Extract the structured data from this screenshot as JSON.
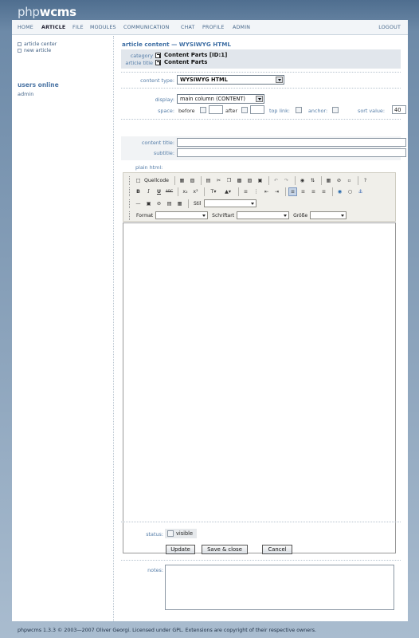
{
  "app": {
    "logo_php": "php",
    "logo_wcms": "wcms"
  },
  "nav": {
    "items": [
      "HOME",
      "ARTICLE",
      "FILE",
      "MODULES",
      "COMMUNICATION",
      "CHAT",
      "PROFILE",
      "ADMIN"
    ],
    "active": "ARTICLE",
    "logout": "LOGOUT"
  },
  "sidebar": {
    "links": [
      "article center",
      "new article"
    ],
    "users_online_heading": "users online",
    "users": [
      "admin"
    ]
  },
  "page": {
    "title": "article content — WYSIWYG HTML"
  },
  "info": {
    "category_label": "category",
    "category_value": "Content Parts [ID:1]",
    "article_title_label": "article title",
    "article_title_value": "Content Parts"
  },
  "form": {
    "content_type_label": "content type:",
    "content_type_value": "WYSIWYG HTML",
    "display_label": "display:",
    "display_value": "main column (CONTENT)",
    "space_label": "space:",
    "before_label": "before",
    "after_label": "after",
    "top_link_label": "top link:",
    "anchor_label": "anchor:",
    "sort_value_label": "sort value:",
    "sort_value": "40",
    "content_title_label": "content title:",
    "subtitle_label": "subtitle:",
    "plain_html_label": "plain html:",
    "status_label": "status:",
    "visible_label": "visible",
    "notes_label": "notes:"
  },
  "editor": {
    "source_label": "Quellcode",
    "style_label": "Stil",
    "format_label": "Format",
    "font_label": "Schriftart",
    "size_label": "Größe",
    "bold": "B",
    "italic": "I",
    "underline": "U",
    "strike": "ABC",
    "sub": "x₂",
    "sup": "x²"
  },
  "buttons": {
    "update": "Update",
    "save_close": "Save & close",
    "cancel": "Cancel"
  },
  "footer": {
    "text": "phpwcms 1.3.3 © 2003—2007 Oliver Georgi. Licensed under GPL. Extensions are copyright of their respective owners."
  }
}
